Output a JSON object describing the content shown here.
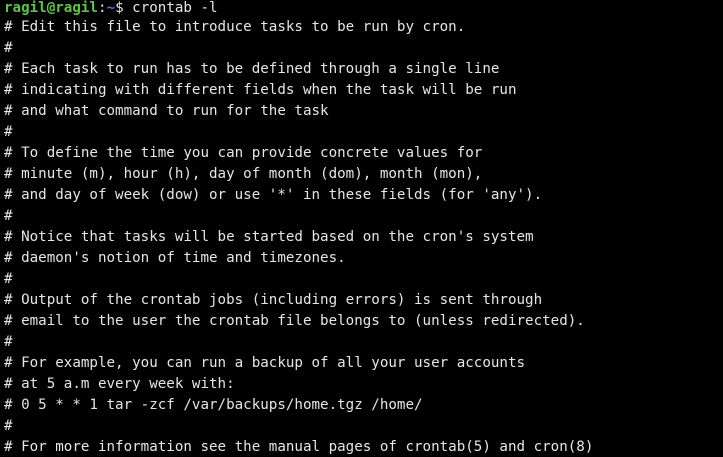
{
  "terminal": {
    "prompt": {
      "user_host": "ragil@ragil",
      "separator": ":",
      "path": "~",
      "symbol": "$ ",
      "command": "crontab -l"
    },
    "lines": [
      "# Edit this file to introduce tasks to be run by cron.",
      "#",
      "# Each task to run has to be defined through a single line",
      "# indicating with different fields when the task will be run",
      "# and what command to run for the task",
      "#",
      "# To define the time you can provide concrete values for",
      "# minute (m), hour (h), day of month (dom), month (mon),",
      "# and day of week (dow) or use '*' in these fields (for 'any').",
      "#",
      "# Notice that tasks will be started based on the cron's system",
      "# daemon's notion of time and timezones.",
      "#",
      "# Output of the crontab jobs (including errors) is sent through",
      "# email to the user the crontab file belongs to (unless redirected).",
      "#",
      "# For example, you can run a backup of all your user accounts",
      "# at 5 a.m every week with:",
      "# 0 5 * * 1 tar -zcf /var/backups/home.tgz /home/",
      "#",
      "# For more information see the manual pages of crontab(5) and cron(8)"
    ],
    "colors": {
      "background": "#000000",
      "text": "#e6e6e6",
      "user_host": "#59c843",
      "path": "#3b78ff"
    }
  }
}
